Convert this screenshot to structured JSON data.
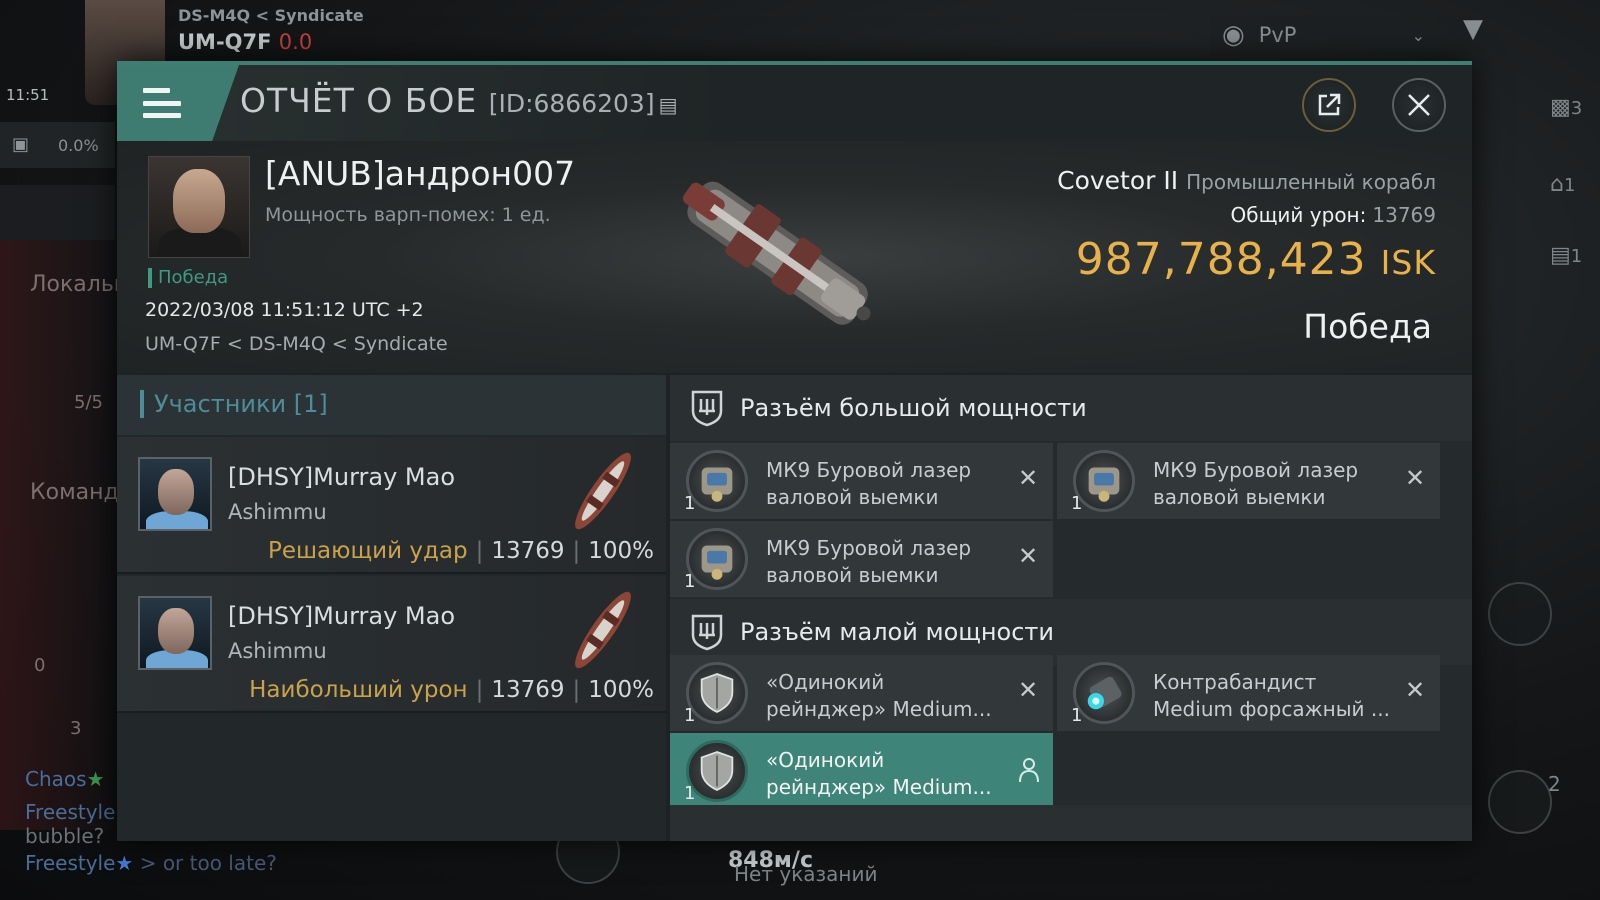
{
  "hud": {
    "region": "DS-M4Q",
    "constellation": "Syndicate",
    "system": "UM-Q7F",
    "security": "0.0",
    "time": "11:51",
    "cargo_pct": "0.0%",
    "filter_mode": "PvP",
    "left_text_1": "Локальн",
    "left_text_2": "Команда",
    "left_count_1": "3",
    "left_count_2": "0",
    "left_ratio": "5/5",
    "chat_line_1_name": "Chaos",
    "chat_line_2_name": "Freestyle",
    "chat_line_2_text": "bubble?",
    "chat_line_3_name": "Freestyle",
    "chat_line_3_text": "> or too late?",
    "right_count_1": "3",
    "right_count_2": "1",
    "right_count_3": "1",
    "right_count_4": "2",
    "speed": "848м/с",
    "no_orders": "Нет указаний",
    "colors": {
      "accent": "#3f7e73",
      "isk": "#e8b24a",
      "role": "#c9a24b",
      "participants_label": "#4e8c99"
    }
  },
  "report": {
    "title": "ОТЧЁТ О БОЕ",
    "id": "[ID:6866203]",
    "victim": {
      "name": "[ANUB]андрон007",
      "warp_disruption": "Мощность варп-помех: 1 ед.",
      "result": "Победа",
      "datetime": "2022/03/08 11:51:12 UTC +2",
      "location": "UM-Q7F < DS-M4Q < Syndicate",
      "ship_name": "Covetor II",
      "ship_type": "Промышленный корабл",
      "total_damage_label": "Общий урон:",
      "total_damage": "13769",
      "isk_value": "987,788,423",
      "isk_unit": "ISK",
      "outcome": "Победа"
    },
    "participants": {
      "label": "Участники [1]",
      "rows": [
        {
          "name": "[DHSY]Murray Mao",
          "ship": "Ashimmu",
          "role": "Решающий удар",
          "damage": "13769",
          "percent": "100%"
        },
        {
          "name": "[DHSY]Murray Mao",
          "ship": "Ashimmu",
          "role": "Наибольший урон",
          "damage": "13769",
          "percent": "100%"
        }
      ]
    },
    "fitting": {
      "high_slot_label": "Разъём большой мощности",
      "high_slots": [
        {
          "name": "МК9 Буровой лазер валовой выемки",
          "qty": "1",
          "icon": "mining-laser-icon"
        },
        {
          "name": "МК9 Буровой лазер валовой выемки",
          "qty": "1",
          "icon": "mining-laser-icon"
        },
        {
          "name": "МК9 Буровой лазер валовой выемки",
          "qty": "1",
          "icon": "mining-laser-icon"
        }
      ],
      "low_slot_label": "Разъём малой мощности",
      "low_slots": [
        {
          "name": "«Одинокий рейнджер» Medium...",
          "qty": "1",
          "icon": "shield-module-icon"
        },
        {
          "name": "Контрабандист Medium форсажный ...",
          "qty": "1",
          "icon": "afterburner-icon"
        },
        {
          "name": "«Одинокий рейнджер» Medium...",
          "qty": "1",
          "icon": "shield-module-icon"
        }
      ]
    }
  }
}
